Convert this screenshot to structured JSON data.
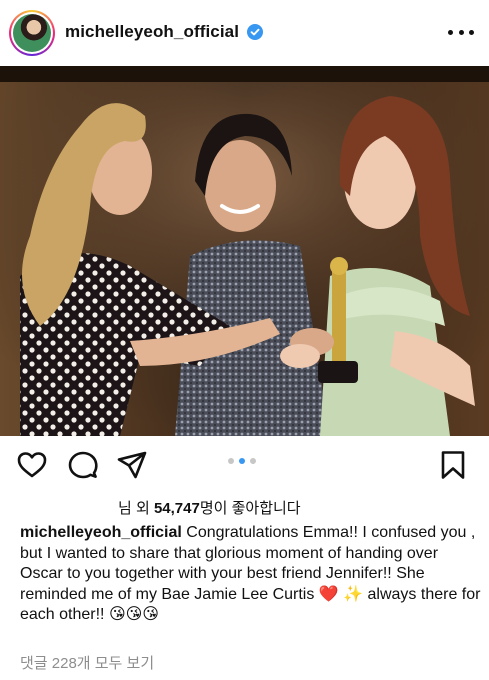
{
  "post": {
    "username": "michelleyeoh_official",
    "likes_prefix": "님 외 ",
    "likes_count": "54,747",
    "likes_suffix": "명이 좋아합니다",
    "caption_user": "michelleyeoh_official",
    "caption_text": " Congratulations Emma!! I confused you , but I wanted to share that glorious moment of handing over Oscar to you together with your best friend Jennifer!! She reminded me of my Bae Jamie Lee Curtis ❤️ ✨ always there for each other!! 😘😘😘",
    "view_comments": "댓글 228개 모두 보기"
  },
  "icons": {
    "like": "heart-icon",
    "comment": "comment-icon",
    "share": "paper-plane-icon",
    "save": "bookmark-icon",
    "more": "more-icon",
    "verified": "verified-badge-icon"
  },
  "carousel": {
    "total": 3,
    "active_index": 1
  },
  "colors": {
    "verified": "#3897f0",
    "active_dot": "#3897f0",
    "muted_text": "#8e8e8e"
  }
}
